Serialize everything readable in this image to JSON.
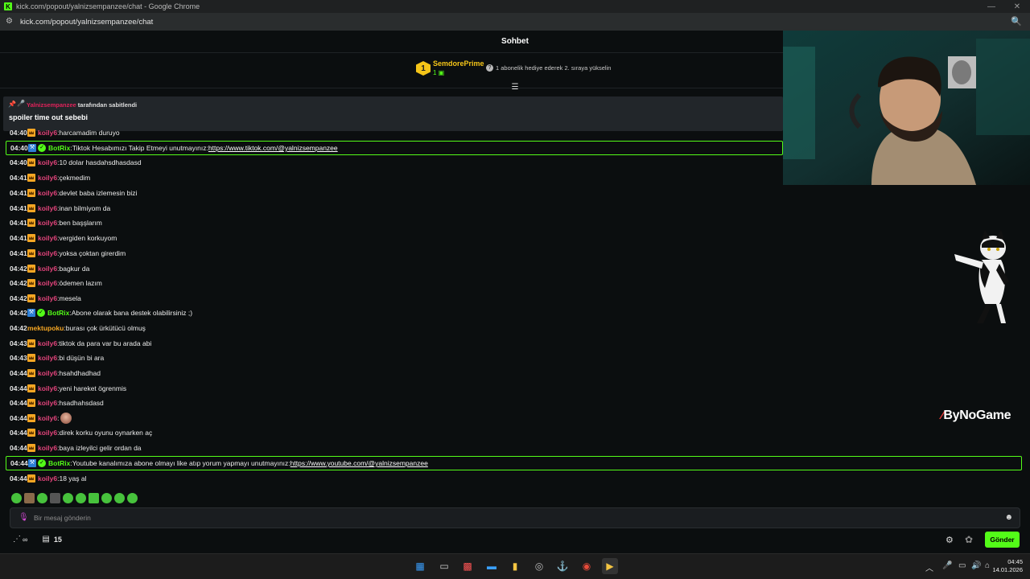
{
  "browser": {
    "title": "kick.com/popout/yalnizsempanzee/chat - Google Chrome",
    "url": "kick.com/popout/yalnizsempanzee/chat",
    "favicon": "kick-logo-icon"
  },
  "chat": {
    "header": "Sohbet",
    "sub_banner": {
      "rank": "1",
      "name": "SemdorePrime",
      "count": "1",
      "gift_text": "1 abonelik hediye ederek 2. sıraya yükselin"
    },
    "pinned": {
      "user": "Yalnizsempanzee",
      "by_text": "tarafından sabitlendi",
      "message": "spoiler time out sebebi"
    },
    "messages": [
      {
        "time": "04:40",
        "user": "koily6",
        "text": "harcamadim duruyo",
        "kind": "koily"
      },
      {
        "time": "04:40",
        "user": "BotRix",
        "text": "Tiktok Hesabımızı Takip Etmeyi unutmayınız: ",
        "link": "https://www.tiktok.com/@yalnizsempanzee",
        "kind": "bot"
      },
      {
        "time": "04:40",
        "user": "koily6",
        "text": "10 dolar hasdahsdhasdasd",
        "kind": "koily"
      },
      {
        "time": "04:41",
        "user": "koily6",
        "text": "çekmedim",
        "kind": "koily"
      },
      {
        "time": "04:41",
        "user": "koily6",
        "text": "devlet baba izlemesin bizi",
        "kind": "koily"
      },
      {
        "time": "04:41",
        "user": "koily6",
        "text": "inan bilmiyom da",
        "kind": "koily"
      },
      {
        "time": "04:41",
        "user": "koily6",
        "text": "ben başşlarım",
        "kind": "koily"
      },
      {
        "time": "04:41",
        "user": "koily6",
        "text": "vergiden korkuyom",
        "kind": "koily"
      },
      {
        "time": "04:41",
        "user": "koily6",
        "text": "yoksa çoktan girerdim",
        "kind": "koily"
      },
      {
        "time": "04:42",
        "user": "koily6",
        "text": "bagkur da",
        "kind": "koily"
      },
      {
        "time": "04:42",
        "user": "koily6",
        "text": "ödemen lazım",
        "kind": "koily"
      },
      {
        "time": "04:42",
        "user": "koily6",
        "text": "mesela",
        "kind": "koily"
      },
      {
        "time": "04:42",
        "user": "BotRix",
        "text": "Abone olarak bana destek olabilirsiniz ;)",
        "kind": "botplain"
      },
      {
        "time": "04:42",
        "user": "mektupoku",
        "text": "burası çok ürkütücü olmuş",
        "kind": "mektup"
      },
      {
        "time": "04:43",
        "user": "koily6",
        "text": "tiktok da para var bu arada abi",
        "kind": "koily"
      },
      {
        "time": "04:43",
        "user": "koily6",
        "text": "bi düşün bi ara",
        "kind": "koily"
      },
      {
        "time": "04:44",
        "user": "koily6",
        "text": "hsahdhadhad",
        "kind": "koily"
      },
      {
        "time": "04:44",
        "user": "koily6",
        "text": "yeni hareket ögrenmis",
        "kind": "koily"
      },
      {
        "time": "04:44",
        "user": "koily6",
        "text": "hsadhahsdasd",
        "kind": "koily"
      },
      {
        "time": "04:44",
        "user": "koily6",
        "text": "",
        "kind": "koily-emote"
      },
      {
        "time": "04:44",
        "user": "koily6",
        "text": "direk korku oyunu oynarken aç",
        "kind": "koily"
      },
      {
        "time": "04:44",
        "user": "koily6",
        "text": "baya izleyilci gelir ordan da",
        "kind": "koily"
      },
      {
        "time": "04:44",
        "user": "BotRix",
        "text": "Youtube kanalımıza abone olmayı like atıp yorum yapmayı unutmayınız: ",
        "link": "https://www.youtube.com/@yalnizsempanzee",
        "kind": "bot"
      },
      {
        "time": "04:44",
        "user": "koily6",
        "text": "18 yaş al",
        "kind": "koily"
      }
    ],
    "input_placeholder": "Bir mesaj gönderin",
    "points_count": "15",
    "send_label": "Gönder"
  },
  "overlay": {
    "brand_name": "ByNoGame"
  },
  "taskbar": {
    "time": "04:45",
    "date": "14.01.2026"
  },
  "colors": {
    "accent": "#53fc18",
    "username_koily": "#e2447b",
    "username_mektup": "#f5a623",
    "gold": "#f5c518",
    "background": "#0b0e0f"
  }
}
